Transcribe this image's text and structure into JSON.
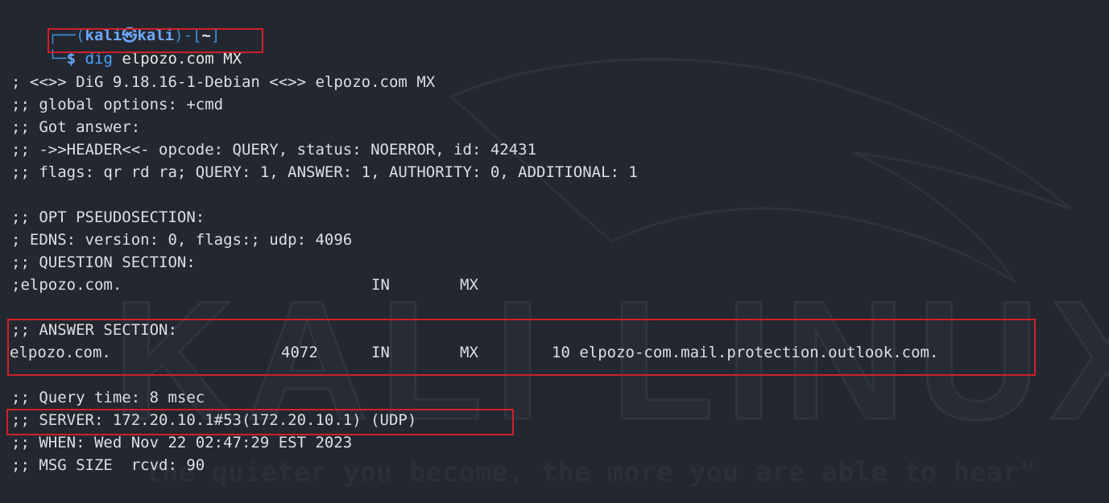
{
  "prompt": {
    "frame_open": "┌──(",
    "user": "kali",
    "at_symbol": "㉿",
    "host": "kali",
    "frame_mid": ")-[",
    "dir": "~",
    "frame_close": "]",
    "frame_bottom": "└─",
    "dollar": "$"
  },
  "command": {
    "program": "dig",
    "args": "elpozo.com MX"
  },
  "output": {
    "banner": "; <<>> DiG 9.18.16-1-Debian <<>> elpozo.com MX",
    "global_options": ";; global options: +cmd",
    "got_answer": ";; Got answer:",
    "header": ";; ->>HEADER<<- opcode: QUERY, status: NOERROR, id: 42431",
    "flags": ";; flags: qr rd ra; QUERY: 1, ANSWER: 1, AUTHORITY: 0, ADDITIONAL: 1",
    "opt_pseudosection": ";; OPT PSEUDOSECTION:",
    "edns": "; EDNS: version: 0, flags:; udp: 4096",
    "question_section": ";; QUESTION SECTION:",
    "question_row": {
      "name": ";elpozo.com.",
      "class": "IN",
      "type": "MX"
    },
    "answer_section": ";; ANSWER SECTION:",
    "answer_row": {
      "name": "elpozo.com.",
      "ttl": "4072",
      "class": "IN",
      "type": "MX",
      "data": "10 elpozo-com.mail.protection.outlook.com."
    },
    "query_time": ";; Query time: 8 msec",
    "server": ";; SERVER: 172.20.10.1#53(172.20.10.1) (UDP)",
    "when": ";; WHEN: Wed Nov 22 02:47:29 EST 2023",
    "msg_size": ";; MSG SIZE  rcvd: 90"
  },
  "watermark": {
    "logo_text": "KALI LINUX",
    "tagline": "\"the quieter you become, the more you are able to hear\""
  },
  "colors": {
    "background": "#232830",
    "text": "#dcdfe4",
    "prompt_blue": "#6fa8ff",
    "highlight_red": "#d0202a"
  }
}
